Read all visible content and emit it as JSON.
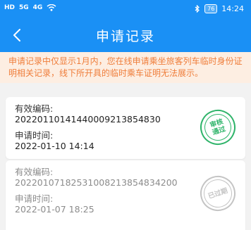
{
  "status_bar": {
    "left_items": [
      "HD",
      "5G",
      "4G",
      "Wi-Fi"
    ],
    "battery": "76",
    "time": "14:24"
  },
  "header": {
    "back_icon": "chevron-left-icon",
    "title": "申请记录"
  },
  "notice": {
    "text": "申请记录中仅显示1月内，您在线申请乘坐旅客列车临时身份证明相关记录，线下所开具的临时乘车证明无法展示。"
  },
  "records": [
    {
      "code_label": "有效编码:",
      "code": "20220110141440009213854830",
      "time_label": "申请时间:",
      "time": "2022-01-10 14:14",
      "stamp": "审核通过"
    },
    {
      "code_label": "有效编码:",
      "code": "20220107182531008213854834200",
      "time_label": "申请时间:",
      "time": "2022-01-07 18:25",
      "stamp": "已过期"
    }
  ],
  "colors": {
    "primary": "#1a90f5",
    "notice_bg": "#fdeee2",
    "notice_text": "#ef7d3a",
    "approved": "#2fb46a",
    "expired": "#c4c4c4"
  }
}
